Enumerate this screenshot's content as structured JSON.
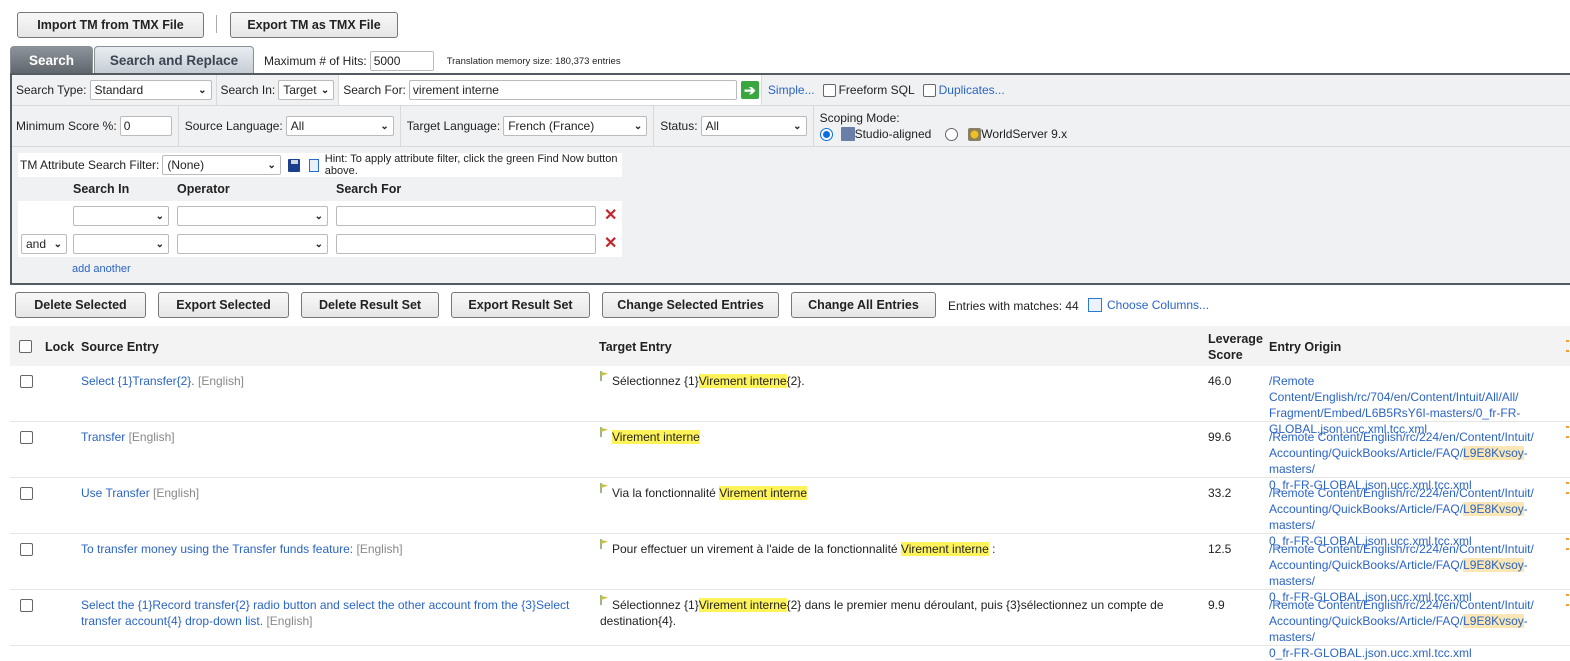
{
  "top_buttons": {
    "import": "Import TM from TMX File",
    "export": "Export TM as TMX File"
  },
  "tabs": [
    {
      "label": "Search",
      "active": true
    },
    {
      "label": "Search and Replace",
      "active": false
    }
  ],
  "max_hits": {
    "label": "Maximum # of Hits:",
    "value": "5000"
  },
  "tm_size": "Translation memory size: 180,373 entries",
  "search": {
    "type_label": "Search Type:",
    "type_value": "Standard",
    "in_label": "Search In:",
    "in_value": "Target",
    "for_label": "Search For:",
    "for_value": "virement interne",
    "simple_link": "Simple...",
    "freeform_label": "Freeform SQL",
    "duplicates_link": "Duplicates..."
  },
  "filters": {
    "min_score_label": "Minimum Score %:",
    "min_score_value": "0",
    "source_lang_label": "Source Language:",
    "source_lang_value": "All",
    "target_lang_label": "Target Language:",
    "target_lang_value": "French (France)",
    "status_label": "Status:",
    "status_value": "All",
    "scoping_label": "Scoping Mode:",
    "scoping_options": [
      {
        "label": "Studio-aligned",
        "selected": true
      },
      {
        "label": "WorldServer 9.x",
        "selected": false
      }
    ]
  },
  "attr_filter": {
    "label": "TM Attribute Search Filter:",
    "value": "(None)",
    "hint": "Hint: To apply attribute filter, click the green Find Now button above.",
    "headers": [
      "Search In",
      "Operator",
      "Search For"
    ],
    "conjunction": "and",
    "add_another": "add another"
  },
  "actions": [
    "Delete Selected",
    "Export Selected",
    "Delete Result Set",
    "Export Result Set",
    "Change Selected Entries",
    "Change All Entries"
  ],
  "entries_with_matches": "Entries with matches: 44",
  "choose_columns": "Choose Columns...",
  "colors": {
    "highlight": "#fff35a",
    "link": "#2a64c5",
    "active_tab": "#6e747b"
  },
  "table": {
    "headers": {
      "lock": "Lock",
      "source": "Source Entry",
      "target": "Target Entry",
      "score_line1": "Leverage",
      "score_line2": "Score",
      "origin": "Entry Origin"
    },
    "rows": [
      {
        "source": "Select {1}Transfer{2}.",
        "source_lang": "[English]",
        "target_pre": "Sélectionnez {1}",
        "target_hl": "Virement interne",
        "target_post": "{2}.",
        "score": "46.0",
        "origin_l1": "/Remote Content/English/rc/704/en/Content/Intuit/All/All/",
        "origin_l2a": "Fragment/Embed/L6B5RsY6I-masters/0_fr-FR-",
        "origin_l2hl": "",
        "origin_l2b": "",
        "origin_l3": "GLOBAL.json.ucc.xml.tcc.xml"
      },
      {
        "source": "Transfer",
        "source_lang": "[English]",
        "target_pre": "",
        "target_hl": "Virement interne",
        "target_post": "",
        "score": "99.6",
        "origin_l1": "/Remote Content/English/rc/224/en/Content/Intuit/",
        "origin_l2a": "Accounting/QuickBooks/Article/FAQ/",
        "origin_l2hl": "L9E8Kvsoy",
        "origin_l2b": "-masters/",
        "origin_l3": "0_fr-FR-GLOBAL.json.ucc.xml.tcc.xml"
      },
      {
        "source": "Use Transfer",
        "source_lang": "[English]",
        "target_pre": "Via la fonctionnalité ",
        "target_hl": "Virement interne",
        "target_post": "",
        "score": "33.2",
        "origin_l1": "/Remote Content/English/rc/224/en/Content/Intuit/",
        "origin_l2a": "Accounting/QuickBooks/Article/FAQ/",
        "origin_l2hl": "L9E8Kvsoy",
        "origin_l2b": "-masters/",
        "origin_l3": "0_fr-FR-GLOBAL.json.ucc.xml.tcc.xml"
      },
      {
        "source": "To transfer money using the Transfer funds feature:",
        "source_lang": "[English]",
        "target_pre": "Pour effectuer un virement à l'aide de la fonctionnalité ",
        "target_hl": "Virement interne",
        "target_post": " :",
        "score": "12.5",
        "origin_l1": "/Remote Content/English/rc/224/en/Content/Intuit/",
        "origin_l2a": "Accounting/QuickBooks/Article/FAQ/",
        "origin_l2hl": "L9E8Kvsoy",
        "origin_l2b": "-masters/",
        "origin_l3": "0_fr-FR-GLOBAL.json.ucc.xml.tcc.xml"
      },
      {
        "source": "Select the {1}Record transfer{2} radio button and select the other account from the {3}Select transfer account{4} drop-down list.",
        "source_lang": "[English]",
        "target_pre": "Sélectionnez {1}",
        "target_hl": "Virement interne",
        "target_post": "{2} dans le premier menu déroulant, puis {3}sélectionnez un compte de destination{4}.",
        "score": "9.9",
        "origin_l1": "/Remote Content/English/rc/224/en/Content/Intuit/",
        "origin_l2a": "Accounting/QuickBooks/Article/FAQ/",
        "origin_l2hl": "L9E8Kvsoy",
        "origin_l2b": "-masters/",
        "origin_l3": "0_fr-FR-GLOBAL.json.ucc.xml.tcc.xml"
      }
    ]
  }
}
